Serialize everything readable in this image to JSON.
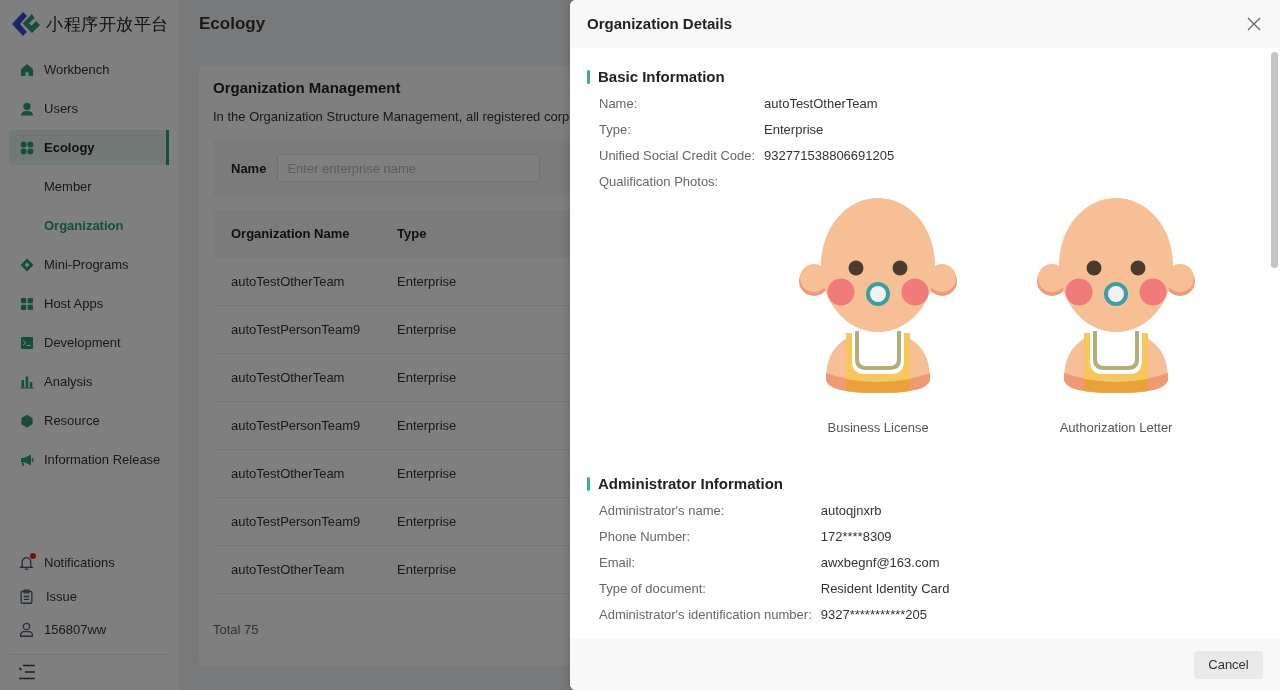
{
  "sidebar": {
    "title": "小程序开放平台",
    "items": [
      {
        "label": "Workbench",
        "selected": false
      },
      {
        "label": "Users",
        "selected": false
      },
      {
        "label": "Ecology",
        "selected": true,
        "children": [
          {
            "label": "Member",
            "selected": false
          },
          {
            "label": "Organization",
            "selected": true
          }
        ]
      },
      {
        "label": "Mini-Programs",
        "selected": false
      },
      {
        "label": "Host Apps",
        "selected": false
      },
      {
        "label": "Development",
        "selected": false
      },
      {
        "label": "Analysis",
        "selected": false
      },
      {
        "label": "Resource",
        "selected": false
      },
      {
        "label": "Information Release",
        "selected": false
      }
    ],
    "footer_items": [
      {
        "label": "Notifications",
        "badge": true
      },
      {
        "label": "Issue",
        "badge": false
      },
      {
        "label": "156807ww",
        "badge": false
      }
    ]
  },
  "header": {
    "title": "Ecology"
  },
  "card": {
    "title": "Organization Management",
    "description": "In the Organization Structure Management, all registered corp",
    "filter": {
      "label": "Name",
      "placeholder": "Enter enterprise name"
    },
    "table": {
      "columns": [
        "Organization Name",
        "Type"
      ],
      "rows": [
        [
          "autoTestOtherTeam",
          "Enterprise"
        ],
        [
          "autoTestPersonTeam9",
          "Enterprise"
        ],
        [
          "autoTestOtherTeam",
          "Enterprise"
        ],
        [
          "autoTestPersonTeam9",
          "Enterprise"
        ],
        [
          "autoTestOtherTeam",
          "Enterprise"
        ],
        [
          "autoTestPersonTeam9",
          "Enterprise"
        ],
        [
          "autoTestOtherTeam",
          "Enterprise"
        ]
      ]
    },
    "total": "Total 75"
  },
  "drawer": {
    "title": "Organization Details",
    "sections": [
      {
        "title": "Basic Information",
        "fields": [
          {
            "kind": "text",
            "label": "Name:",
            "value": "autoTestOtherTeam"
          },
          {
            "kind": "text",
            "label": "Type:",
            "value": "Enterprise"
          },
          {
            "kind": "text",
            "label": "Unified Social Credit Code:",
            "value": "932771538806691205"
          },
          {
            "kind": "photos",
            "label": "Qualification Photos:",
            "photos": [
              {
                "caption": "Business License"
              },
              {
                "caption": "Authorization Letter"
              }
            ]
          }
        ]
      },
      {
        "title": "Administrator Information",
        "fields": [
          {
            "kind": "text",
            "label": "Administrator's name:",
            "value": "autoqjnxrb"
          },
          {
            "kind": "text",
            "label": "Phone Number:",
            "value": "172****8309"
          },
          {
            "kind": "text",
            "label": "Email:",
            "value": "awxbegnf@163.com"
          },
          {
            "kind": "text",
            "label": "Type of document:",
            "value": "Resident Identity Card"
          },
          {
            "kind": "text",
            "label": "Administrator's identification number:",
            "value": "9327***********205"
          }
        ]
      }
    ],
    "buttons": [
      "Cancel"
    ]
  }
}
